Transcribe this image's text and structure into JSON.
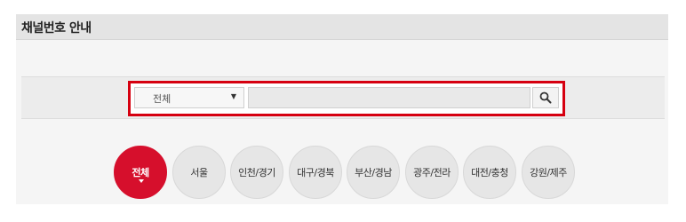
{
  "header": {
    "title": "채널번호 안내"
  },
  "search": {
    "select_value": "전체",
    "input_value": "",
    "input_placeholder": "",
    "button_icon": "search-icon"
  },
  "regions": {
    "active": "전체",
    "items": [
      "전체",
      "서울",
      "인천/경기",
      "대구/경북",
      "부산/경남",
      "광주/전라",
      "대전/충청",
      "강원/제주"
    ]
  },
  "colors": {
    "accent_red": "#d60f2c",
    "search_border_red": "#d60010",
    "tab_gray": "#e6e6e6",
    "title_bar": "#e4e4e4"
  }
}
